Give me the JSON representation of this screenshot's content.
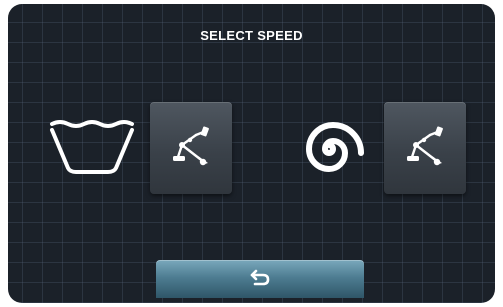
{
  "screen": {
    "title": "SELECT SPEED"
  },
  "options": [
    {
      "icon": "wash-tub-icon",
      "action_icon": "tool-settings-icon"
    },
    {
      "icon": "spin-spiral-icon",
      "action_icon": "tool-settings-icon"
    }
  ],
  "footer": {
    "back_icon": "back-arrow-icon"
  },
  "colors": {
    "background": "#1b2129",
    "grid": "#3a4656",
    "button": "#3f464e",
    "back_button": "#4e7d92",
    "foreground": "#ffffff"
  }
}
